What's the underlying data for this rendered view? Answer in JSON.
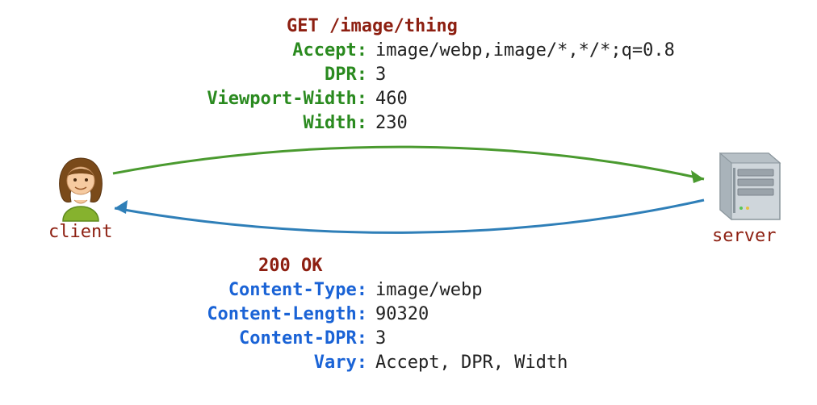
{
  "request": {
    "line": "GET /image/thing",
    "headers": [
      {
        "name": "Accept:",
        "value": "image/webp,image/*,*/*;q=0.8"
      },
      {
        "name": "DPR:",
        "value": "3"
      },
      {
        "name": "Viewport-Width:",
        "value": "460"
      },
      {
        "name": "Width:",
        "value": "230"
      }
    ]
  },
  "response": {
    "line": "200 OK",
    "headers": [
      {
        "name": "Content-Type:",
        "value": "image/webp"
      },
      {
        "name": "Content-Length:",
        "value": "90320"
      },
      {
        "name": "Content-DPR:",
        "value": "3"
      },
      {
        "name": "Vary:",
        "value": "Accept, DPR, Width"
      }
    ]
  },
  "labels": {
    "client": "client",
    "server": "server"
  },
  "colors": {
    "request_header": "#2a8a1f",
    "response_header": "#1a63d6",
    "line_color": "#8d1f11",
    "request_arrow": "#4a9a2f",
    "response_arrow": "#2f7fb8"
  }
}
